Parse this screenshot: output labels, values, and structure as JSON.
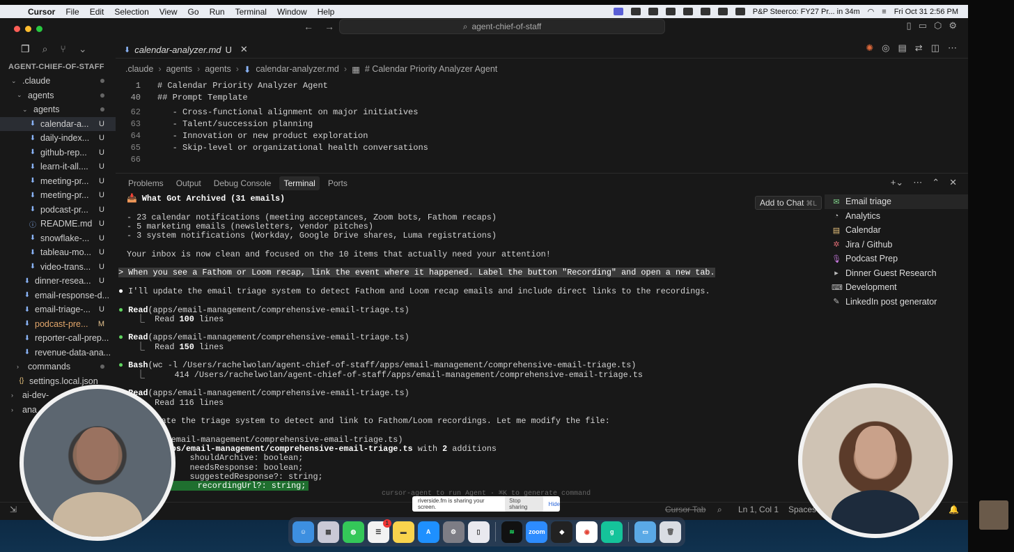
{
  "menubar": {
    "app": "Cursor",
    "items": [
      "File",
      "Edit",
      "Selection",
      "View",
      "Go",
      "Run",
      "Terminal",
      "Window",
      "Help"
    ],
    "calendar_event": "P&P Steerco: FY27 Pr... in 34m",
    "clock": "Fri Oct 31 2:56 PM"
  },
  "titlebar": {
    "search_text": "agent-chief-of-staff",
    "traffic_colors": [
      "#ff5f57",
      "#febc2e",
      "#28c840"
    ]
  },
  "sidebar": {
    "title": "AGENT-CHIEF-OF-STAFF",
    "items": [
      {
        "label": ".claude",
        "kind": "folder",
        "indent": 1
      },
      {
        "label": "agents",
        "kind": "folder",
        "indent": 2
      },
      {
        "label": "agents",
        "kind": "folder",
        "indent": 3
      },
      {
        "label": "calendar-a...",
        "kind": "file",
        "indent": 4,
        "status": "U",
        "selected": true
      },
      {
        "label": "daily-index...",
        "kind": "file",
        "indent": 4,
        "status": "U"
      },
      {
        "label": "github-rep...",
        "kind": "file",
        "indent": 4,
        "status": "U"
      },
      {
        "label": "learn-it-all....",
        "kind": "file",
        "indent": 4,
        "status": "U"
      },
      {
        "label": "meeting-pr...",
        "kind": "file",
        "indent": 4,
        "status": "U"
      },
      {
        "label": "meeting-pr...",
        "kind": "file",
        "indent": 4,
        "status": "U"
      },
      {
        "label": "podcast-pr...",
        "kind": "file",
        "indent": 4,
        "status": "U"
      },
      {
        "label": "README.md",
        "kind": "info",
        "indent": 4,
        "status": "U"
      },
      {
        "label": "snowflake-...",
        "kind": "file",
        "indent": 4,
        "status": "U"
      },
      {
        "label": "tableau-mo...",
        "kind": "file",
        "indent": 4,
        "status": "U"
      },
      {
        "label": "video-trans...",
        "kind": "file",
        "indent": 4,
        "status": "U"
      },
      {
        "label": "dinner-resea...",
        "kind": "file",
        "indent": 3,
        "status": "U"
      },
      {
        "label": "email-response-d...",
        "kind": "file",
        "indent": 3,
        "status": ""
      },
      {
        "label": "email-triage-...",
        "kind": "file",
        "indent": 3,
        "status": "U"
      },
      {
        "label": "podcast-pre...",
        "kind": "file",
        "indent": 3,
        "status": "M",
        "modified": true
      },
      {
        "label": "reporter-call-prep...",
        "kind": "file",
        "indent": 3,
        "status": ""
      },
      {
        "label": "revenue-data-ana...",
        "kind": "file",
        "indent": 3,
        "status": ""
      },
      {
        "label": "commands",
        "kind": "folder-closed",
        "indent": 2
      },
      {
        "label": "settings.local.json",
        "kind": "json",
        "indent": 2
      },
      {
        "label": "ai-dev-",
        "kind": "folder-closed",
        "indent": 1
      },
      {
        "label": "ana",
        "kind": "folder-closed",
        "indent": 1
      }
    ]
  },
  "editor": {
    "tab_label": "calendar-analyzer.md",
    "tab_status": "U",
    "breadcrumb": [
      ".claude",
      "agents",
      "agents",
      "calendar-analyzer.md",
      "# Calendar Priority Analyzer Agent"
    ],
    "lines": [
      {
        "num": "1",
        "text": "# Calendar Priority Analyzer Agent",
        "sticky": true
      },
      {
        "num": "40",
        "text": "## Prompt Template",
        "sticky": true
      },
      {
        "num": "62",
        "text": "   - Cross-functional alignment on major initiatives"
      },
      {
        "num": "63",
        "text": "   - Talent/succession planning"
      },
      {
        "num": "64",
        "text": "   - Innovation or new product exploration"
      },
      {
        "num": "65",
        "text": "   - Skip-level or organizational health conversations"
      },
      {
        "num": "66",
        "text": ""
      }
    ]
  },
  "panel": {
    "tabs": [
      "Problems",
      "Output",
      "Debug Console",
      "Terminal",
      "Ports"
    ],
    "active_tab": "Terminal",
    "add_to_chat": "Add to Chat",
    "add_to_chat_key": "⌘L"
  },
  "terminal": {
    "archived_title": "What Got Archived (31 emails)",
    "archived_items": [
      "- 23 calendar notifications (meeting acceptances, Zoom bots, Fathom recaps)",
      "- 5 marketing emails (newsletters, vendor pitches)",
      "- 3 system notifications (Workday, Google Drive shares, Luma registrations)"
    ],
    "inbox_clean": "Your inbox is now clean and focused on the 10 items that actually need your attention!",
    "user_prompt": "> When you see a Fathom or Loom recap, link the event where it happened. Label the button \"Recording\" and open a new tab.",
    "reply": "I'll update the email triage system to detect Fathom and Loom recap emails and include direct links to the recordings.",
    "read1_tool": "Read",
    "read1_arg": "(apps/email-management/comprehensive-email-triage.ts)",
    "read1_result_pre": "Read ",
    "read1_result_num": "100",
    "read1_result_post": " lines",
    "read2_tool": "Read",
    "read2_arg": "(apps/email-management/comprehensive-email-triage.ts)",
    "read2_result_pre": "Read ",
    "read2_result_num": "150",
    "read2_result_post": " lines",
    "bash_tool": "Bash",
    "bash_arg": "(wc -l /Users/rachelwolan/agent-chief-of-staff/apps/email-management/comprehensive-email-triage.ts)",
    "bash_result": "      414 /Users/rachelwolan/agent-chief-of-staff/apps/email-management/comprehensive-email-triage.ts",
    "read3_tool": "Read",
    "read3_arg": "(apps/email-management/comprehensive-email-triage.ts)",
    "read3_result": "Read 116 lines",
    "update_text": "update the triage system to detect and link to Fathom/Loom recordings. Let me modify the file:",
    "update_call": "apps/email-management/comprehensive-email-triage.ts)",
    "updated_pre": "ed ",
    "updated_file": "apps/email-management/comprehensive-email-triage.ts",
    "updated_post": " with ",
    "updated_num": "2",
    "updated_tail": " additions",
    "diff_lines": [
      "      shouldArchive: boolean;",
      "      needsResponse: boolean;",
      "      suggestedResponse?: string;"
    ],
    "diff_added_marker": "+",
    "diff_added": "      recordingUrl?: string;",
    "hint": "cursor-agent to run Agent · ⌘K to generate command"
  },
  "sessions": [
    {
      "label": "Email triage",
      "icon": "mail-icon",
      "selected": true
    },
    {
      "label": "Analytics",
      "icon": "analytics-icon"
    },
    {
      "label": "Calendar",
      "icon": "calendar-icon"
    },
    {
      "label": "Jira / Github",
      "icon": "bug-icon"
    },
    {
      "label": "Podcast Prep",
      "icon": "mic-icon"
    },
    {
      "label": "Dinner Guest Research",
      "icon": "terminal-icon"
    },
    {
      "label": "Development",
      "icon": "keyboard-icon"
    },
    {
      "label": "LinkedIn post generator",
      "icon": "edit-icon"
    }
  ],
  "statusbar": {
    "cursor_tab": "Cursor Tab",
    "position": "Ln 1, Col 1",
    "spaces": "Spaces"
  },
  "share_popup": {
    "text": "riverside.fm is sharing your screen.",
    "stop": "Stop sharing",
    "hide": "Hide"
  },
  "dock": {
    "reminders_badge": "1",
    "zoom_label": "zoom"
  }
}
